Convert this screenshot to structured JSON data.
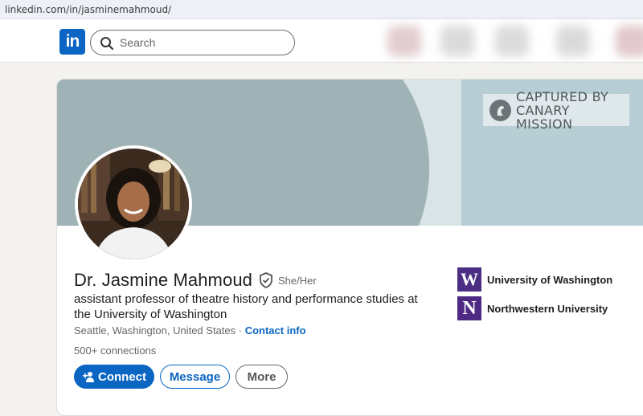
{
  "browser": {
    "url": "linkedin.com/in/jasminemahmoud/"
  },
  "nav": {
    "logo_text": "in",
    "search_placeholder": "Search",
    "logo_color": "#0a66c2"
  },
  "banner": {
    "watermark_line1": "CAPTURED BY",
    "watermark_line2": "CANARY MISSION"
  },
  "profile": {
    "name": "Dr. Jasmine Mahmoud",
    "pronouns": "She/Her",
    "headline": "assistant professor of theatre history and performance studies at the University of Washington",
    "location": "Seattle, Washington, United States",
    "separator": " · ",
    "contact_info": "Contact info",
    "connections": "500+ connections"
  },
  "actions": {
    "connect": "Connect",
    "message": "Message",
    "more": "More"
  },
  "education": [
    {
      "logo": "W",
      "name": "University of Washington"
    },
    {
      "logo": "N",
      "name": "Northwestern University"
    }
  ],
  "colors": {
    "accent": "#0a66c2",
    "banner": "#9fb2b6",
    "uw_purple": "#4b2e83"
  }
}
